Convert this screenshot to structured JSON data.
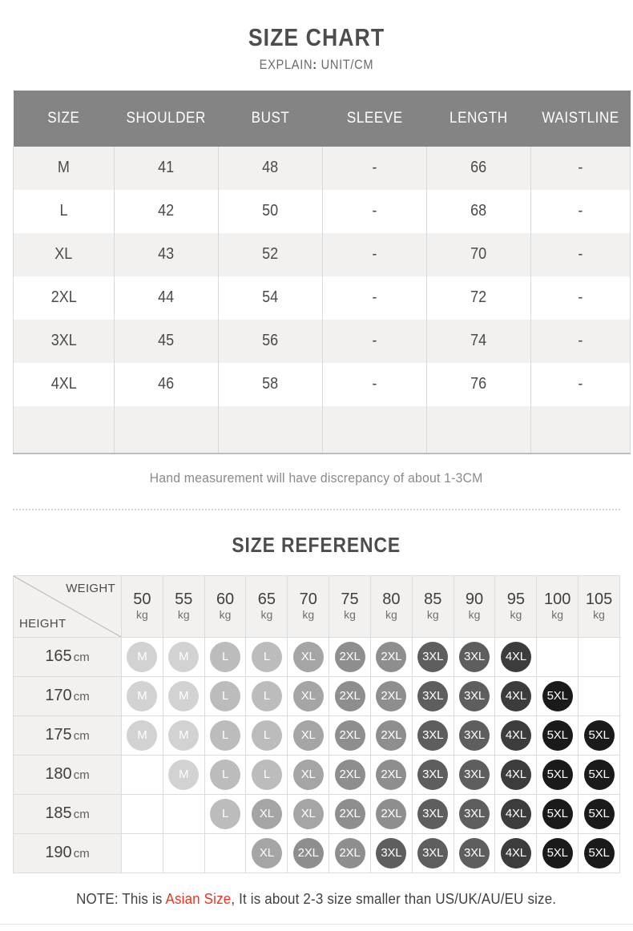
{
  "header": {
    "title": "SIZE CHART",
    "explain_label": "EXPLAIN",
    "explain_colon": ":",
    "explain_value": "UNIT/CM"
  },
  "size_chart": {
    "columns": [
      "SIZE",
      "SHOULDER",
      "BUST",
      "SLEEVE",
      "LENGTH",
      "WAISTLINE"
    ],
    "rows": [
      {
        "size": "M",
        "shoulder": "41",
        "bust": "48",
        "sleeve": "-",
        "length": "66",
        "waistline": "-"
      },
      {
        "size": "L",
        "shoulder": "42",
        "bust": "50",
        "sleeve": "-",
        "length": "68",
        "waistline": "-"
      },
      {
        "size": "XL",
        "shoulder": "43",
        "bust": "52",
        "sleeve": "-",
        "length": "70",
        "waistline": "-"
      },
      {
        "size": "2XL",
        "shoulder": "44",
        "bust": "54",
        "sleeve": "-",
        "length": "72",
        "waistline": "-"
      },
      {
        "size": "3XL",
        "shoulder": "45",
        "bust": "56",
        "sleeve": "-",
        "length": "74",
        "waistline": "-"
      },
      {
        "size": "4XL",
        "shoulder": "46",
        "bust": "58",
        "sleeve": "-",
        "length": "76",
        "waistline": "-"
      }
    ],
    "footnote": "Hand measurement will have discrepancy of about 1-3CM"
  },
  "size_reference": {
    "title": "SIZE REFERENCE",
    "weight_axis_label": "WEIGHT",
    "height_axis_label": "HEIGHT",
    "weight_unit": "kg",
    "height_unit": "cm",
    "weights": [
      "50",
      "55",
      "60",
      "65",
      "70",
      "75",
      "80",
      "85",
      "90",
      "95",
      "100",
      "105"
    ],
    "heights": [
      "165",
      "170",
      "175",
      "180",
      "185",
      "190"
    ],
    "grid": [
      [
        "M",
        "M",
        "L",
        "L",
        "XL",
        "2XL",
        "2XL",
        "3XL",
        "3XL",
        "4XL",
        "",
        ""
      ],
      [
        "M",
        "M",
        "L",
        "L",
        "XL",
        "2XL",
        "2XL",
        "3XL",
        "3XL",
        "4XL",
        "5XL",
        ""
      ],
      [
        "M",
        "M",
        "L",
        "L",
        "XL",
        "2XL",
        "2XL",
        "3XL",
        "3XL",
        "4XL",
        "5XL",
        "5XL"
      ],
      [
        "",
        "M",
        "L",
        "L",
        "XL",
        "2XL",
        "2XL",
        "3XL",
        "3XL",
        "4XL",
        "5XL",
        "5XL"
      ],
      [
        "",
        "",
        "L",
        "XL",
        "XL",
        "2XL",
        "2XL",
        "3XL",
        "3XL",
        "4XL",
        "5XL",
        "5XL"
      ],
      [
        "",
        "",
        "",
        "XL",
        "2XL",
        "2XL",
        "3XL",
        "3XL",
        "3XL",
        "4XL",
        "5XL",
        "5XL"
      ]
    ]
  },
  "note": {
    "prefix": "NOTE: This is ",
    "highlight": "Asian Size",
    "suffix": ", It is about 2-3 size smaller than US/UK/AU/EU size."
  },
  "colors": {
    "header_bg": "#848484",
    "row_shade": "#f2f1ef",
    "highlight_red": "#f6301c",
    "badge_M": "#d2d2d2",
    "badge_L": "#bcbcbc",
    "badge_XL": "#a5a5a5",
    "badge_2XL": "#8e8e8e",
    "badge_3XL": "#5e5e5e",
    "badge_4XL": "#3c3c3c",
    "badge_5XL": "#1a1a1a"
  }
}
